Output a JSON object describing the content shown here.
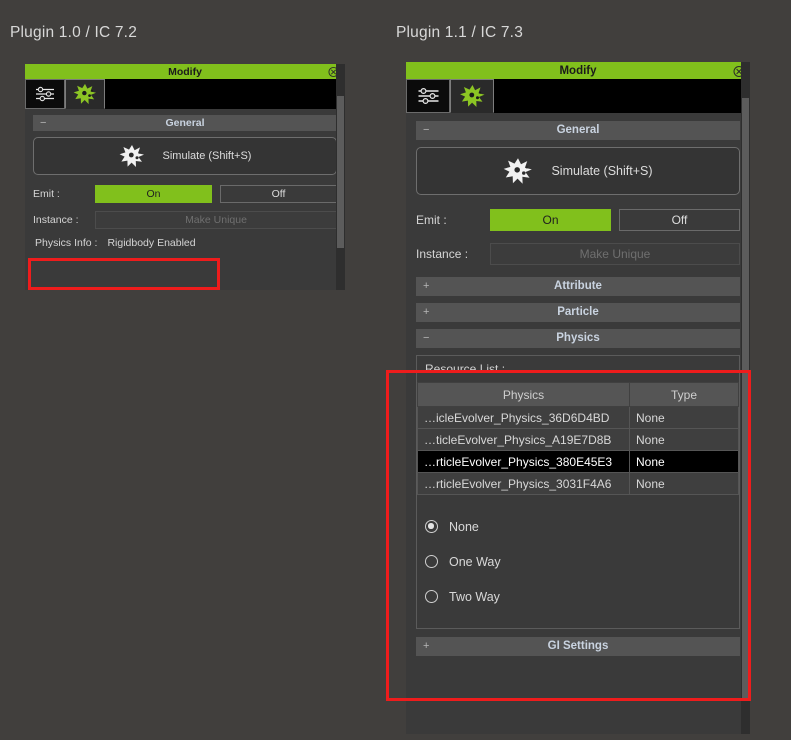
{
  "captions": {
    "left": "Plugin 1.0 / IC 7.2",
    "right": "Plugin 1.1 / IC 7.3"
  },
  "colors": {
    "accent_green": "#81c01c",
    "highlight_red": "#ee1c1c",
    "window_bg": "#3a3a3a",
    "page_bg": "#413f3d",
    "section_header": "#545454"
  },
  "left_panel": {
    "title": "Modify",
    "close_icon": "close-circle-icon",
    "tabs": [
      {
        "name": "sliders-icon",
        "active": false
      },
      {
        "name": "particle-burst-icon",
        "active": true
      }
    ],
    "sections": {
      "general": {
        "label": "General",
        "toggle": "−"
      }
    },
    "simulate": {
      "label": "Simulate (Shift+S)",
      "icon": "burst-icon"
    },
    "emit": {
      "label": "Emit :",
      "on": "On",
      "off": "Off",
      "selected": "On"
    },
    "instance": {
      "label": "Instance :",
      "button": "Make Unique",
      "disabled": true
    },
    "physics_info": {
      "label": "Physics Info :",
      "value": "Rigidbody Enabled"
    }
  },
  "right_panel": {
    "title": "Modify",
    "close_icon": "close-circle-icon",
    "tabs": [
      {
        "name": "sliders-icon",
        "active": false
      },
      {
        "name": "particle-burst-icon",
        "active": true
      }
    ],
    "sections": {
      "general": {
        "label": "General",
        "toggle": "−"
      },
      "attribute": {
        "label": "Attribute",
        "toggle": "+"
      },
      "particle": {
        "label": "Particle",
        "toggle": "+"
      },
      "physics": {
        "label": "Physics",
        "toggle": "−"
      },
      "gi_settings": {
        "label": "GI Settings",
        "toggle": "+"
      }
    },
    "simulate": {
      "label": "Simulate (Shift+S)",
      "icon": "burst-icon"
    },
    "emit": {
      "label": "Emit :",
      "on": "On",
      "off": "Off",
      "selected": "On"
    },
    "instance": {
      "label": "Instance :",
      "button": "Make Unique",
      "disabled": true
    },
    "resource_list": {
      "title": "Resource List :",
      "columns": [
        "Physics",
        "Type"
      ],
      "rows": [
        {
          "physics": "…icleEvolver_Physics_36D6D4BD",
          "type": "None",
          "selected": false
        },
        {
          "physics": "…ticleEvolver_Physics_A19E7D8B",
          "type": "None",
          "selected": false
        },
        {
          "physics": "…rticleEvolver_Physics_380E45E3",
          "type": "None",
          "selected": true
        },
        {
          "physics": "…rticleEvolver_Physics_3031F4A6",
          "type": "None",
          "selected": false
        }
      ]
    },
    "collision_mode": {
      "options": [
        {
          "label": "None",
          "selected": true
        },
        {
          "label": "One Way",
          "selected": false
        },
        {
          "label": "Two Way",
          "selected": false
        }
      ]
    }
  }
}
